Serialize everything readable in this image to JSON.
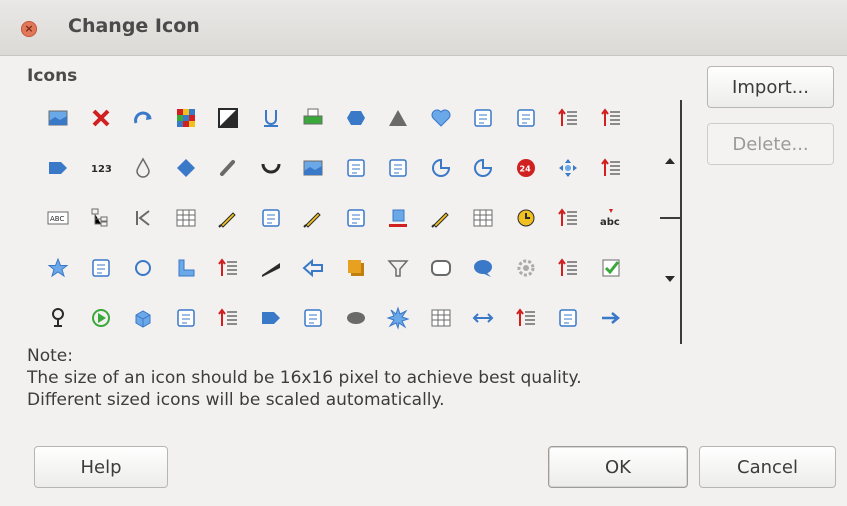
{
  "window": {
    "title": "Change Icon",
    "close_glyph": "×"
  },
  "icons_label": "Icons",
  "buttons": {
    "import": "Import...",
    "delete": "Delete...",
    "help": "Help",
    "ok": "OK",
    "cancel": "Cancel"
  },
  "note": {
    "heading": "Note:",
    "line1": "The size of an icon should be 16x16 pixel to achieve best quality.",
    "line2": "Different sized icons will be scaled automatically."
  },
  "icon_rows": [
    [
      "image-icon",
      "delete-x-icon",
      "redo-arc-icon",
      "color-grid-icon",
      "contrast-frame-icon",
      "underline-icon",
      "printer-icon",
      "hexagon-icon",
      "triangle-icon",
      "heart-icon",
      "paste-special-icon",
      "refresh-browser-icon",
      "form-list-icon",
      "promote-list-icon"
    ],
    [
      "pentagon-arrow-icon",
      "numeric-123-icon",
      "droplet-icon",
      "diamond-icon",
      "paperclip-icon",
      "arc-icon",
      "image-frame-icon",
      "shapes-icon",
      "document-edit-icon",
      "chart-up-icon",
      "pie-segment-icon",
      "calendar-24-icon",
      "move-arrows-icon",
      "list-sort-icon"
    ],
    [
      "abc-field-icon",
      "tree-structure-icon",
      "first-record-icon",
      "table-grid-icon",
      "paint-brush-icon",
      "pointer-page-icon",
      "pencil-edit-icon",
      "scissors-points-icon",
      "highlight-red-icon",
      "bezier-pen-icon",
      "form-controls-icon",
      "clock-icon",
      "list-align-icon",
      "spellcheck-abc-icon"
    ],
    [
      "star-icon",
      "delete-pin-icon",
      "circle-icon",
      "corner-shape-icon",
      "numbered-list-icon",
      "slanted-bar-icon",
      "back-arrow-icon",
      "square-shadow-icon",
      "filter-funnel-icon",
      "rounded-rect-icon",
      "speech-bubble-icon",
      "gear-icon",
      "checklist-icon",
      "new-note-icon"
    ],
    [
      "pin-stand-icon",
      "play-circle-icon",
      "cube-icon",
      "frame-layers-icon",
      "tab-order-icon",
      "pentagon-shape-icon",
      "text-scale-icon",
      "ellipse-icon",
      "explosion-icon",
      "form-grid-icon",
      "double-arrow-icon",
      "promote-items-icon",
      "dial-settings-icon",
      "right-arrow-icon"
    ]
  ]
}
